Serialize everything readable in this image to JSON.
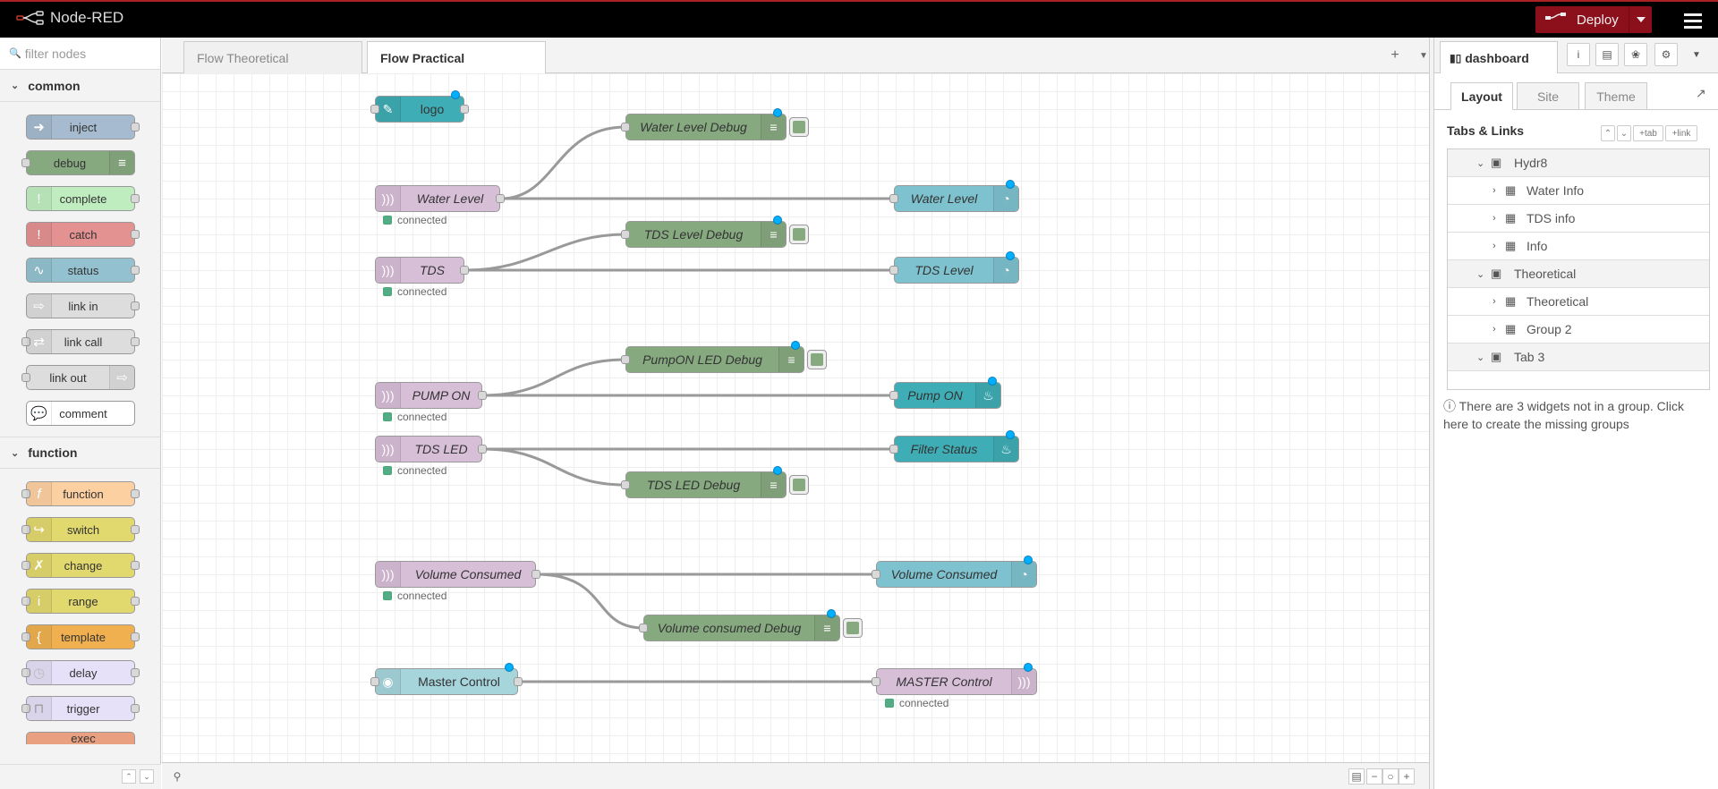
{
  "header": {
    "app_title": "Node-RED",
    "deploy_label": "Deploy"
  },
  "palette": {
    "filter_placeholder": "filter nodes",
    "categories": [
      {
        "name": "common",
        "nodes": [
          "inject",
          "debug",
          "complete",
          "catch",
          "status",
          "link in",
          "link call",
          "link out",
          "comment"
        ]
      },
      {
        "name": "function",
        "nodes": [
          "function",
          "switch",
          "change",
          "range",
          "template",
          "delay",
          "trigger",
          "exec"
        ]
      }
    ]
  },
  "workspace_tabs": [
    "Flow Theoretical",
    "Flow Practical"
  ],
  "active_tab": "Flow Practical",
  "flow": {
    "nodes": {
      "logo": "logo",
      "water_level_debug": "Water Level Debug",
      "water_level_in": "Water Level",
      "water_level_gauge": "Water Level",
      "tds_level_debug": "TDS Level Debug",
      "tds_in": "TDS",
      "tds_level_gauge": "TDS Level",
      "pumpon_led_debug": "PumpON LED Debug",
      "pump_on_in": "PUMP ON",
      "pump_on_led": "Pump ON",
      "tds_led_in": "TDS LED",
      "filter_status_led": "Filter Status",
      "tds_led_debug": "TDS LED Debug",
      "volume_in": "Volume Consumed",
      "volume_gauge": "Volume Consumed",
      "volume_debug": "Volume consumed Debug",
      "master_control_switch": "Master Control",
      "master_control_out": "MASTER Control"
    },
    "status_connected": "connected"
  },
  "sidebar": {
    "active_tab": "dashboard",
    "subtabs": [
      "Layout",
      "Site",
      "Theme"
    ],
    "tabs_links_header": "Tabs & Links",
    "buttons": {
      "tab": "tab",
      "link": "link"
    },
    "tree": [
      {
        "type": "tab",
        "label": "Hydr8"
      },
      {
        "type": "group",
        "label": "Water Info"
      },
      {
        "type": "group",
        "label": "TDS info"
      },
      {
        "type": "group",
        "label": "Info"
      },
      {
        "type": "tab",
        "label": "Theoretical"
      },
      {
        "type": "group",
        "label": "Theoretical"
      },
      {
        "type": "group",
        "label": "Group 2"
      },
      {
        "type": "tab",
        "label": "Tab 3"
      }
    ],
    "info_text": "There are 3 widgets not in a group. Click here to create the missing groups"
  },
  "colors": {
    "header_bg": "#000000",
    "deploy": "#8c101c",
    "mqtt_node": "#d8bfd8",
    "debug_node": "#87a980",
    "ui_node": "#7ec2cf",
    "status_dot": "#00b0ff"
  }
}
